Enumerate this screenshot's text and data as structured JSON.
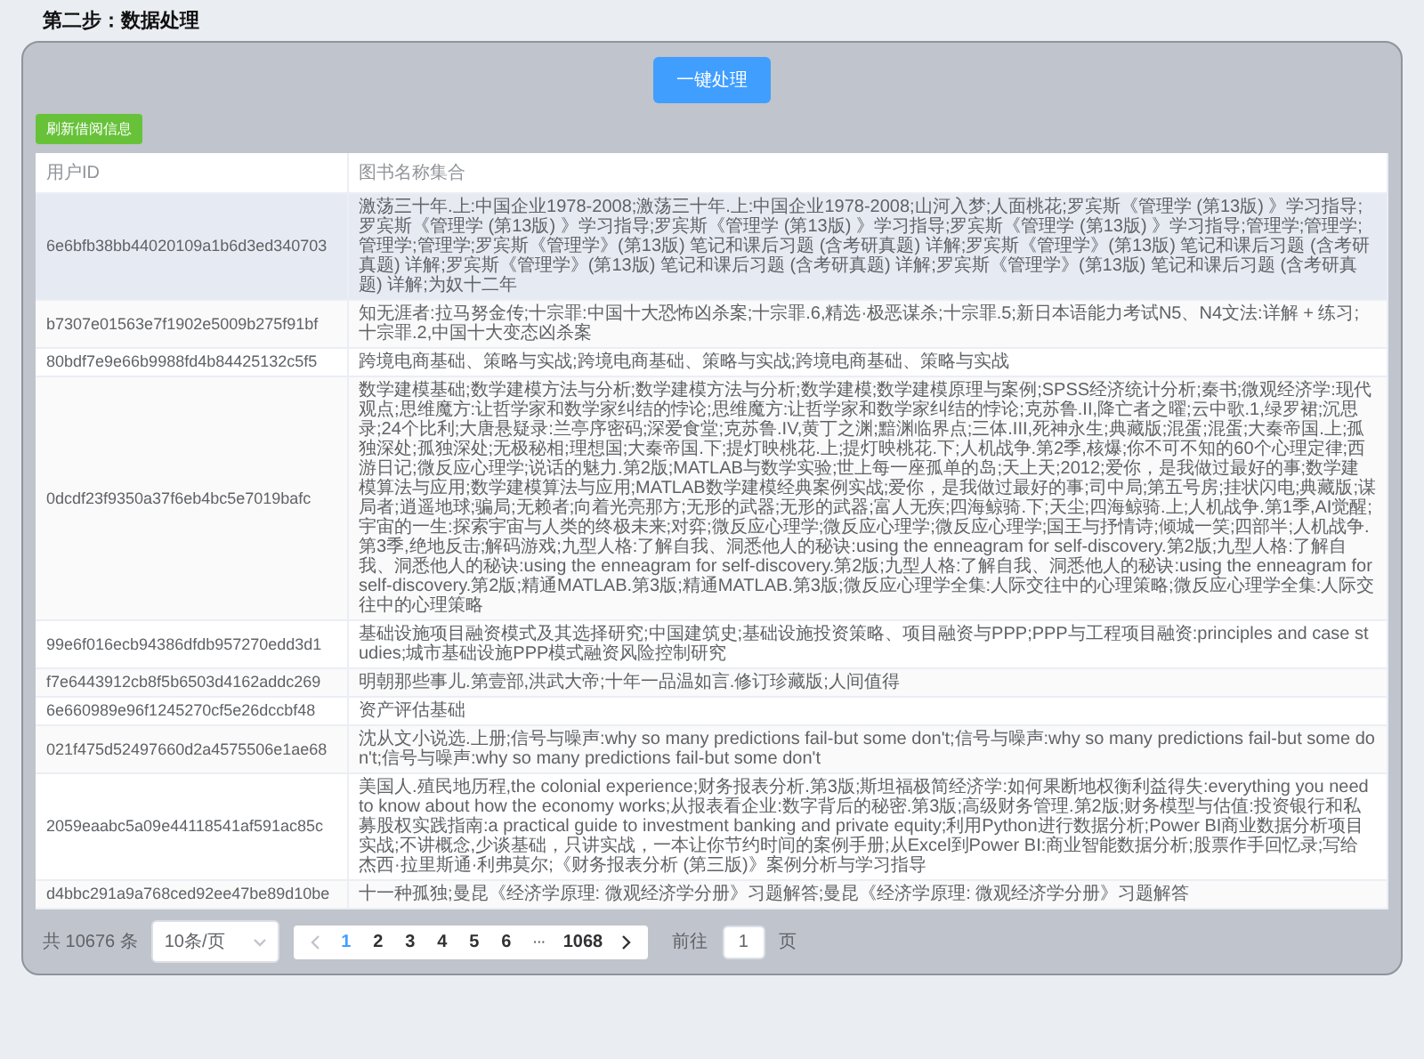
{
  "title": "第二步：数据处理",
  "process_button": "一键处理",
  "refresh_button": "刷新借阅信息",
  "table": {
    "columns": [
      "用户ID",
      "图书名称集合"
    ],
    "rows": [
      {
        "user_id": "6e6bfb38bb44020109a1b6d3ed340703",
        "books": "激荡三十年.上:中国企业1978-2008;激荡三十年.上:中国企业1978-2008;山河入梦;人面桃花;罗宾斯《管理学 (第13版) 》学习指导;罗宾斯《管理学 (第13版) 》学习指导;罗宾斯《管理学 (第13版) 》学习指导;罗宾斯《管理学 (第13版) 》学习指导;管理学;管理学;管理学;管理学;罗宾斯《管理学》(第13版) 笔记和课后习题 (含考研真题) 详解;罗宾斯《管理学》(第13版) 笔记和课后习题 (含考研真题) 详解;罗宾斯《管理学》(第13版) 笔记和课后习题 (含考研真题) 详解;罗宾斯《管理学》(第13版) 笔记和课后习题 (含考研真题) 详解;为奴十二年",
        "highlighted": true
      },
      {
        "user_id": "b7307e01563e7f1902e5009b275f91bf",
        "books": "知无涯者:拉马努金传;十宗罪:中国十大恐怖凶杀案;十宗罪.6,精选·极恶谋杀;十宗罪.5;新日本语能力考试N5、N4文法:详解 + 练习;十宗罪.2,中国十大变态凶杀案",
        "highlighted": false
      },
      {
        "user_id": "80bdf7e9e66b9988fd4b84425132c5f5",
        "books": "跨境电商基础、策略与实战;跨境电商基础、策略与实战;跨境电商基础、策略与实战",
        "highlighted": false
      },
      {
        "user_id": "0dcdf23f9350a37f6eb4bc5e7019bafc",
        "books": "数学建模基础;数学建模方法与分析;数学建模方法与分析;数学建模;数学建模原理与案例;SPSS经济统计分析;秦书;微观经济学:现代观点;思维魔方:让哲学家和数学家纠结的悖论;思维魔方:让哲学家和数学家纠结的悖论;克苏鲁.II,降亡者之曜;云中歌.1,绿罗裙;沉思录;24个比利;大唐悬疑录:兰亭序密码;深爱食堂;克苏鲁.IV,黄丁之渊;黯渊临界点;三体.III,死神永生;典藏版;混蛋;混蛋;大秦帝国.上;孤独深处;孤独深处;无极秘相;理想国;大秦帝国.下;提灯映桃花.上;提灯映桃花.下;人机战争.第2季,核爆;你不可不知的60个心理定律;西游日记;微反应心理学;说话的魅力.第2版;MATLAB与数学实验;世上每一座孤单的岛;天上天;2012;爱你，是我做过最好的事;数学建模算法与应用;数学建模算法与应用;MATLAB数学建模经典案例实战;爱你，是我做过最好的事;司中局;第五号房;挂状闪电;典藏版;谋局者;逍遥地球;骗局;无赖者;向着光亮那方;无形的武器;无形的武器;富人无疾;四海鲸骑.下;天尘;四海鲸骑.上;人机战争.第1季,AI觉醒;宇宙的一生:探索宇宙与人类的终极未来;对弈;微反应心理学;微反应心理学;微反应心理学;国王与抒情诗;倾城一笑;四部半;人机战争.第3季,绝地反击;解码游戏;九型人格:了解自我、洞悉他人的秘诀:using the enneagram for self-discovery.第2版;九型人格:了解自我、洞悉他人的秘诀:using the enneagram for self-discovery.第2版;九型人格:了解自我、洞悉他人的秘诀:using the enneagram for self-discovery.第2版;精通MATLAB.第3版;精通MATLAB.第3版;微反应心理学全集:人际交往中的心理策略;微反应心理学全集:人际交往中的心理策略",
        "highlighted": false
      },
      {
        "user_id": "99e6f016ecb94386dfdb957270edd3d1",
        "books": "基础设施项目融资模式及其选择研究;中国建筑史;基础设施投资策略、项目融资与PPP;PPP与工程项目融资:principles and case studies;城市基础设施PPP模式融资风险控制研究",
        "highlighted": false
      },
      {
        "user_id": "f7e6443912cb8f5b6503d4162addc269",
        "books": "明朝那些事儿.第壹部,洪武大帝;十年一品温如言.修订珍藏版;人间值得",
        "highlighted": false
      },
      {
        "user_id": "6e660989e96f1245270cf5e26dccbf48",
        "books": "资产评估基础",
        "highlighted": false
      },
      {
        "user_id": "021f475d52497660d2a4575506e1ae68",
        "books": "沈从文小说选.上册;信号与噪声:why so many predictions fail-but some don't;信号与噪声:why so many predictions fail-but some don't;信号与噪声:why so many predictions fail-but some don't",
        "highlighted": false
      },
      {
        "user_id": "2059eaabc5a09e44118541af591ac85c",
        "books": "美国人.殖民地历程,the colonial experience;财务报表分析.第3版;斯坦福极简经济学:如何果断地权衡利益得失:everything you need to know about how the economy works;从报表看企业:数字背后的秘密.第3版;高级财务管理.第2版;财务模型与估值:投资银行和私募股权实践指南:a practical guide to investment banking and private equity;利用Python进行数据分析;Power BI商业数据分析项目实战;不讲概念,少谈基础，只讲实战，一本让你节约时间的案例手册;从Excel到Power BI:商业智能数据分析;股票作手回忆录;写给杰西·拉里斯通·利弗莫尔;《财务报表分析 (第三版)》案例分析与学习指导",
        "highlighted": false
      },
      {
        "user_id": "d4bbc291a9a768ced92ee47be89d10be",
        "books": "十一种孤独;曼昆《经济学原理: 微观经济学分册》习题解答;曼昆《经济学原理: 微观经济学分册》习题解答",
        "highlighted": false
      }
    ]
  },
  "pagination": {
    "total": "共 10676 条",
    "page_size": "10条/页",
    "prev_disabled": true,
    "next_disabled": false,
    "pages": [
      {
        "kind": "page",
        "label": "1",
        "selected": true
      },
      {
        "kind": "page",
        "label": "2",
        "selected": false
      },
      {
        "kind": "page",
        "label": "3",
        "selected": false
      },
      {
        "kind": "page",
        "label": "4",
        "selected": false
      },
      {
        "kind": "page",
        "label": "5",
        "selected": false
      },
      {
        "kind": "page",
        "label": "6",
        "selected": false
      },
      {
        "kind": "ellipsis",
        "label": "···"
      },
      {
        "kind": "page",
        "label": "1068",
        "selected": false
      }
    ],
    "goto_label": "前往",
    "goto_value": "1",
    "goto_suffix": "页"
  }
}
